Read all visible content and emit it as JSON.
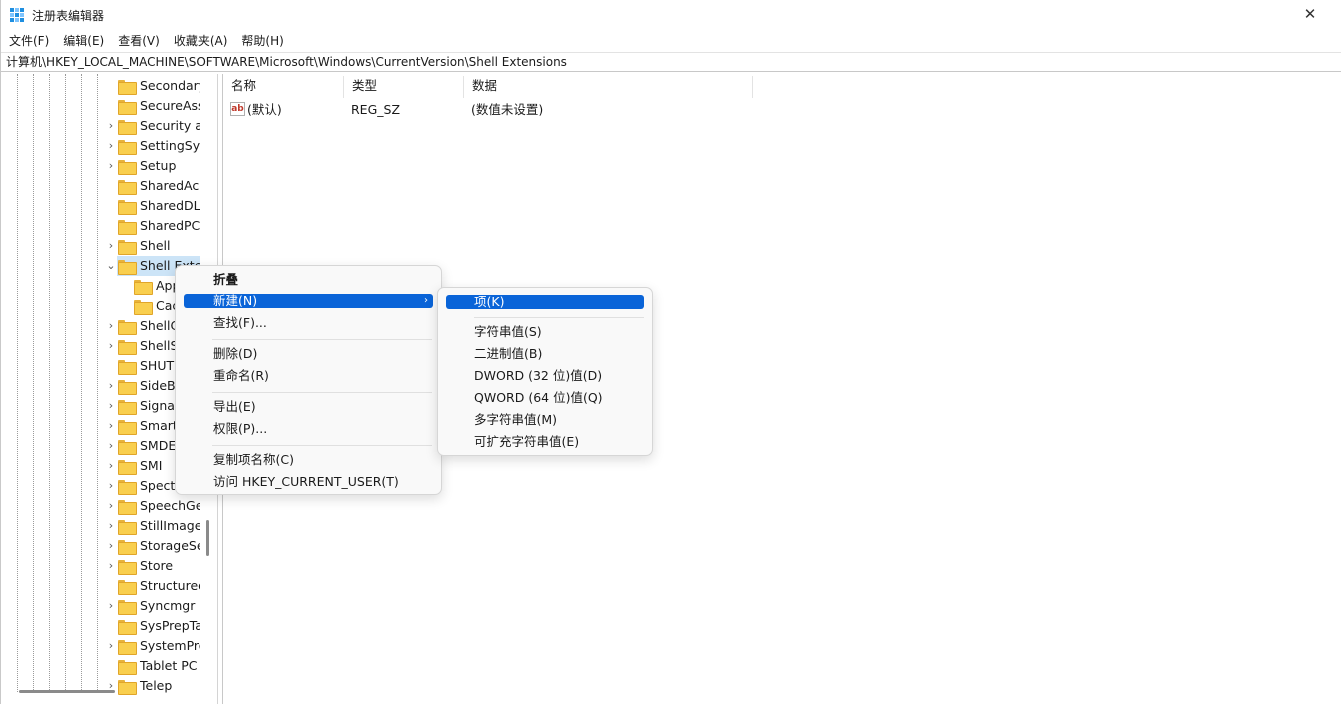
{
  "window": {
    "title": "注册表编辑器",
    "close_glyph": "✕"
  },
  "menubar": {
    "items": [
      "文件(F)",
      "编辑(E)",
      "查看(V)",
      "收藏夹(A)",
      "帮助(H)"
    ]
  },
  "address": {
    "path": "计算机\\HKEY_LOCAL_MACHINE\\SOFTWARE\\Microsoft\\Windows\\CurrentVersion\\Shell Extensions"
  },
  "tree": {
    "items": [
      {
        "label": "Secondary",
        "expander": "none",
        "child": false
      },
      {
        "label": "SecureAss",
        "expander": "none",
        "child": false
      },
      {
        "label": "Security ar",
        "expander": "collapsed",
        "child": false
      },
      {
        "label": "SettingSyn",
        "expander": "collapsed",
        "child": false
      },
      {
        "label": "Setup",
        "expander": "collapsed",
        "child": false
      },
      {
        "label": "SharedAcc",
        "expander": "none",
        "child": false
      },
      {
        "label": "SharedDLL",
        "expander": "none",
        "child": false
      },
      {
        "label": "SharedPC",
        "expander": "none",
        "child": false
      },
      {
        "label": "Shell",
        "expander": "collapsed",
        "child": false
      },
      {
        "label": "Shell Exten",
        "expander": "expanded",
        "child": false,
        "selected": true
      },
      {
        "label": "App",
        "expander": "none",
        "child": true
      },
      {
        "label": "Cac",
        "expander": "none",
        "child": true
      },
      {
        "label": "ShellC",
        "expander": "collapsed",
        "child": false
      },
      {
        "label": "ShellS",
        "expander": "collapsed",
        "child": false
      },
      {
        "label": "SHUTI",
        "expander": "none",
        "child": false
      },
      {
        "label": "SideBy",
        "expander": "collapsed",
        "child": false
      },
      {
        "label": "Signal",
        "expander": "collapsed",
        "child": false
      },
      {
        "label": "Smart",
        "expander": "collapsed",
        "child": false
      },
      {
        "label": "SMDE",
        "expander": "collapsed",
        "child": false
      },
      {
        "label": "SMI",
        "expander": "collapsed",
        "child": false
      },
      {
        "label": "Spectr",
        "expander": "collapsed",
        "child": false
      },
      {
        "label": "SpeechGe",
        "expander": "collapsed",
        "child": false
      },
      {
        "label": "StillImage",
        "expander": "collapsed",
        "child": false
      },
      {
        "label": "StorageSe",
        "expander": "collapsed",
        "child": false
      },
      {
        "label": "Store",
        "expander": "collapsed",
        "child": false
      },
      {
        "label": "Structured",
        "expander": "none",
        "child": false
      },
      {
        "label": "Syncmgr",
        "expander": "collapsed",
        "child": false
      },
      {
        "label": "SysPrepTa",
        "expander": "none",
        "child": false
      },
      {
        "label": "SystemPro",
        "expander": "collapsed",
        "child": false
      },
      {
        "label": "Tablet PC",
        "expander": "none",
        "child": false
      },
      {
        "label": "Telep",
        "expander": "collapsed",
        "child": false
      }
    ]
  },
  "columns": {
    "name": "名称",
    "type": "类型",
    "data": "数据"
  },
  "values": [
    {
      "name": "(默认)",
      "type": "REG_SZ",
      "data": "(数值未设置)",
      "icon": "ab"
    }
  ],
  "context_menu": {
    "collapse": "折叠",
    "new": "新建(N)",
    "find": "查找(F)...",
    "delete": "删除(D)",
    "rename": "重命名(R)",
    "export": "导出(E)",
    "permissions": "权限(P)...",
    "copy_key_name": "复制项名称(C)",
    "goto_hkcu": "访问 HKEY_CURRENT_USER(T)",
    "submenu_arrow": "›"
  },
  "submenu": {
    "key": "项(K)",
    "string": "字符串值(S)",
    "binary": "二进制值(B)",
    "dword": "DWORD (32 位)值(D)",
    "qword": "QWORD (64 位)值(Q)",
    "multi_string": "多字符串值(M)",
    "expandable_string": "可扩充字符串值(E)"
  },
  "colors": {
    "highlight": "#0a64d8",
    "tree_selection": "#cce4f7",
    "folder": "#f9cf4e"
  }
}
